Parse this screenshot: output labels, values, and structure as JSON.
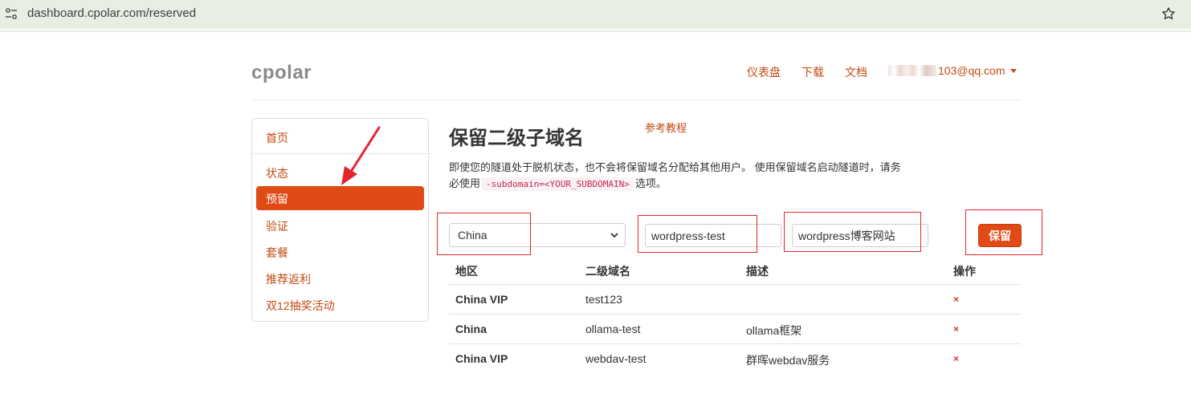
{
  "browser": {
    "url": "dashboard.cpolar.com/reserved"
  },
  "header": {
    "brand": "cpolar",
    "nav": [
      "仪表盘",
      "下载",
      "文档"
    ],
    "user_email": "103@qq.com"
  },
  "sidebar": {
    "items": [
      {
        "label": "首页",
        "active": false
      },
      {
        "label": "状态",
        "active": false
      },
      {
        "label": "预留",
        "active": true
      },
      {
        "label": "验证",
        "active": false
      },
      {
        "label": "套餐",
        "active": false
      },
      {
        "label": "推荐返利",
        "active": false
      },
      {
        "label": "双12抽奖活动",
        "active": false
      }
    ]
  },
  "main": {
    "title": "保留二级子域名",
    "tutorial_link": "参考教程",
    "description_part1": "即使您的隧道处于脱机状态，也不会将保留域名分配给其他用户。 使用保留域名启动隧道时，请务必使用",
    "description_code": "-subdomain=<YOUR_SUBDOMAIN>",
    "description_part2": "选项。",
    "form": {
      "region_selected": "China",
      "subdomain_value": "wordpress-test",
      "description_value": "wordpress博客网站",
      "save_label": "保留"
    },
    "table": {
      "headers": [
        "地区",
        "二级域名",
        "描述",
        "操作"
      ],
      "rows": [
        {
          "region": "China VIP",
          "subdomain": "test123",
          "description": "",
          "action": "×"
        },
        {
          "region": "China",
          "subdomain": "ollama-test",
          "description": "ollama框架",
          "action": "×"
        },
        {
          "region": "China VIP",
          "subdomain": "webdav-test",
          "description": "群晖webdav服务",
          "action": "×"
        }
      ]
    }
  },
  "colors": {
    "accent": "#e04a15",
    "link": "#c24a12",
    "highlight_box": "#e5252c"
  }
}
